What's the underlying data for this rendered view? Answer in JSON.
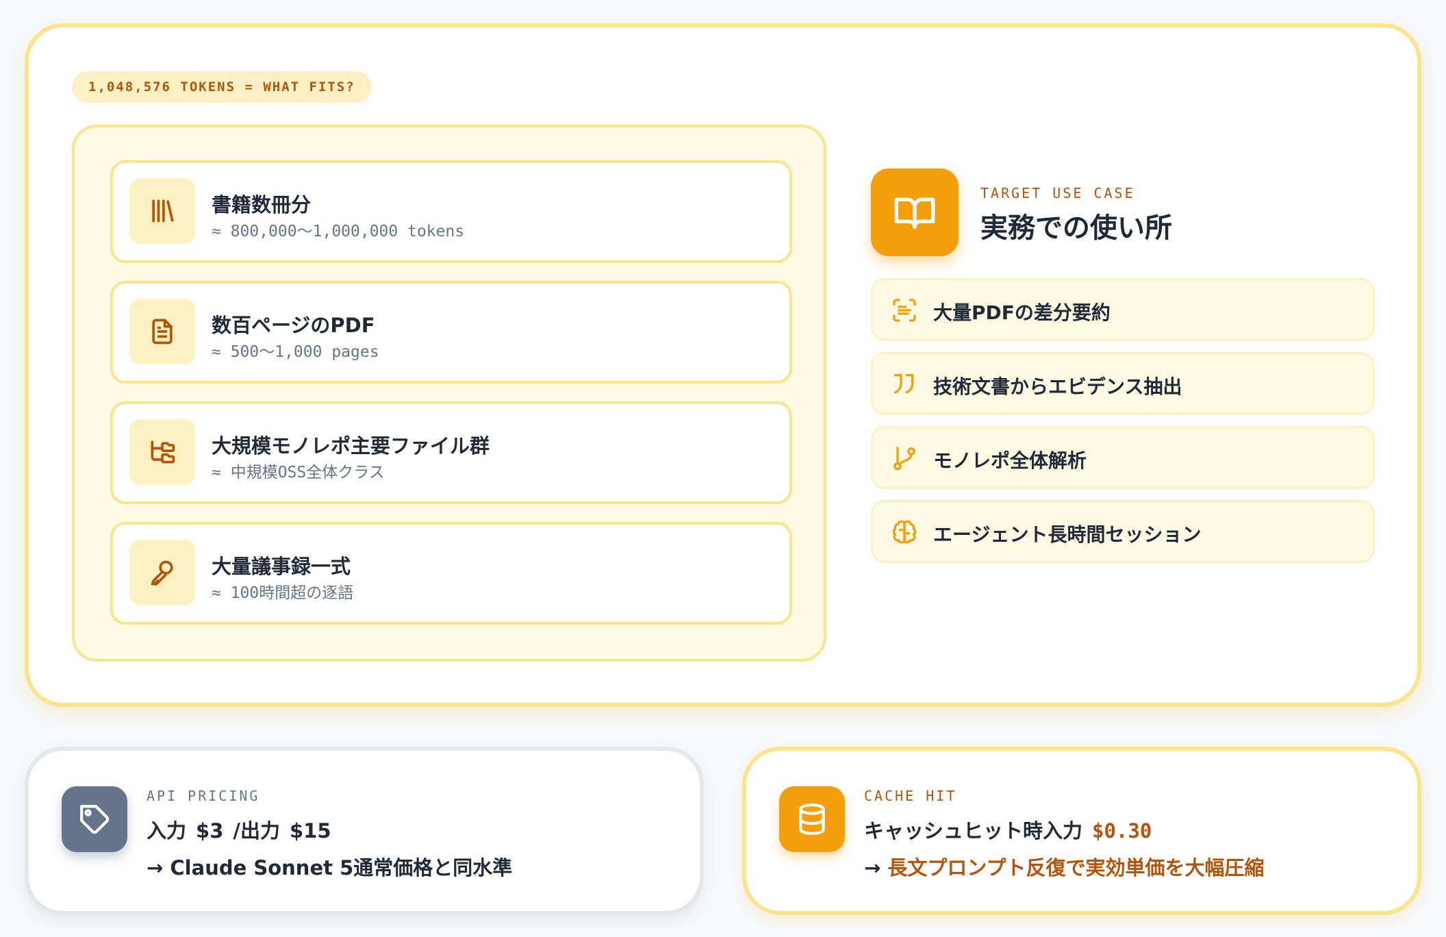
{
  "header": {
    "tokens_pill": "1,048,576 TOKENS = WHAT FITS?"
  },
  "fits": [
    {
      "icon": "library-icon",
      "title": "書籍数冊分",
      "sub": "≈ 800,000〜1,000,000 tokens"
    },
    {
      "icon": "document-icon",
      "title": "数百ページのPDF",
      "sub": "≈ 500〜1,000 pages"
    },
    {
      "icon": "folder-tree-icon",
      "title": "大規模モノレポ主要ファイル群",
      "sub": "≈ 中規模OSS全体クラス"
    },
    {
      "icon": "microphone-icon",
      "title": "大量議事録一式",
      "sub": "≈ 100時間超の逐語"
    }
  ],
  "use_case": {
    "label": "TARGET USE CASE",
    "title": "実務での使い所",
    "icon": "open-book-icon",
    "items": [
      {
        "icon": "scan-text-icon",
        "label": "大量PDFの差分要約"
      },
      {
        "icon": "quote-icon",
        "label": "技術文書からエビデンス抽出"
      },
      {
        "icon": "git-branch-icon",
        "label": "モノレポ全体解析"
      },
      {
        "icon": "brain-icon",
        "label": "エージェント長時間セッション"
      }
    ]
  },
  "api_pricing": {
    "icon": "price-tag-icon",
    "label": "API PRICING",
    "input_label": "入力",
    "input_price": "$3",
    "separator": "/",
    "output_label": "出力",
    "output_price": "$15",
    "note": "→ Claude Sonnet 5通常価格と同水準"
  },
  "cache_hit": {
    "icon": "database-icon",
    "label": "CACHE HIT",
    "line_label": "キャッシュヒット時入力",
    "price": "$0.30",
    "arrow": "→",
    "note": "長文プロンプト反復で実効単価を大幅圧縮"
  },
  "colors": {
    "amber": "#f59e0b",
    "amber_dark": "#b45309",
    "amber_border": "#fbe48c",
    "amber_soft": "#fdf0c2",
    "slate": "#64748b",
    "text": "#1f2937"
  }
}
